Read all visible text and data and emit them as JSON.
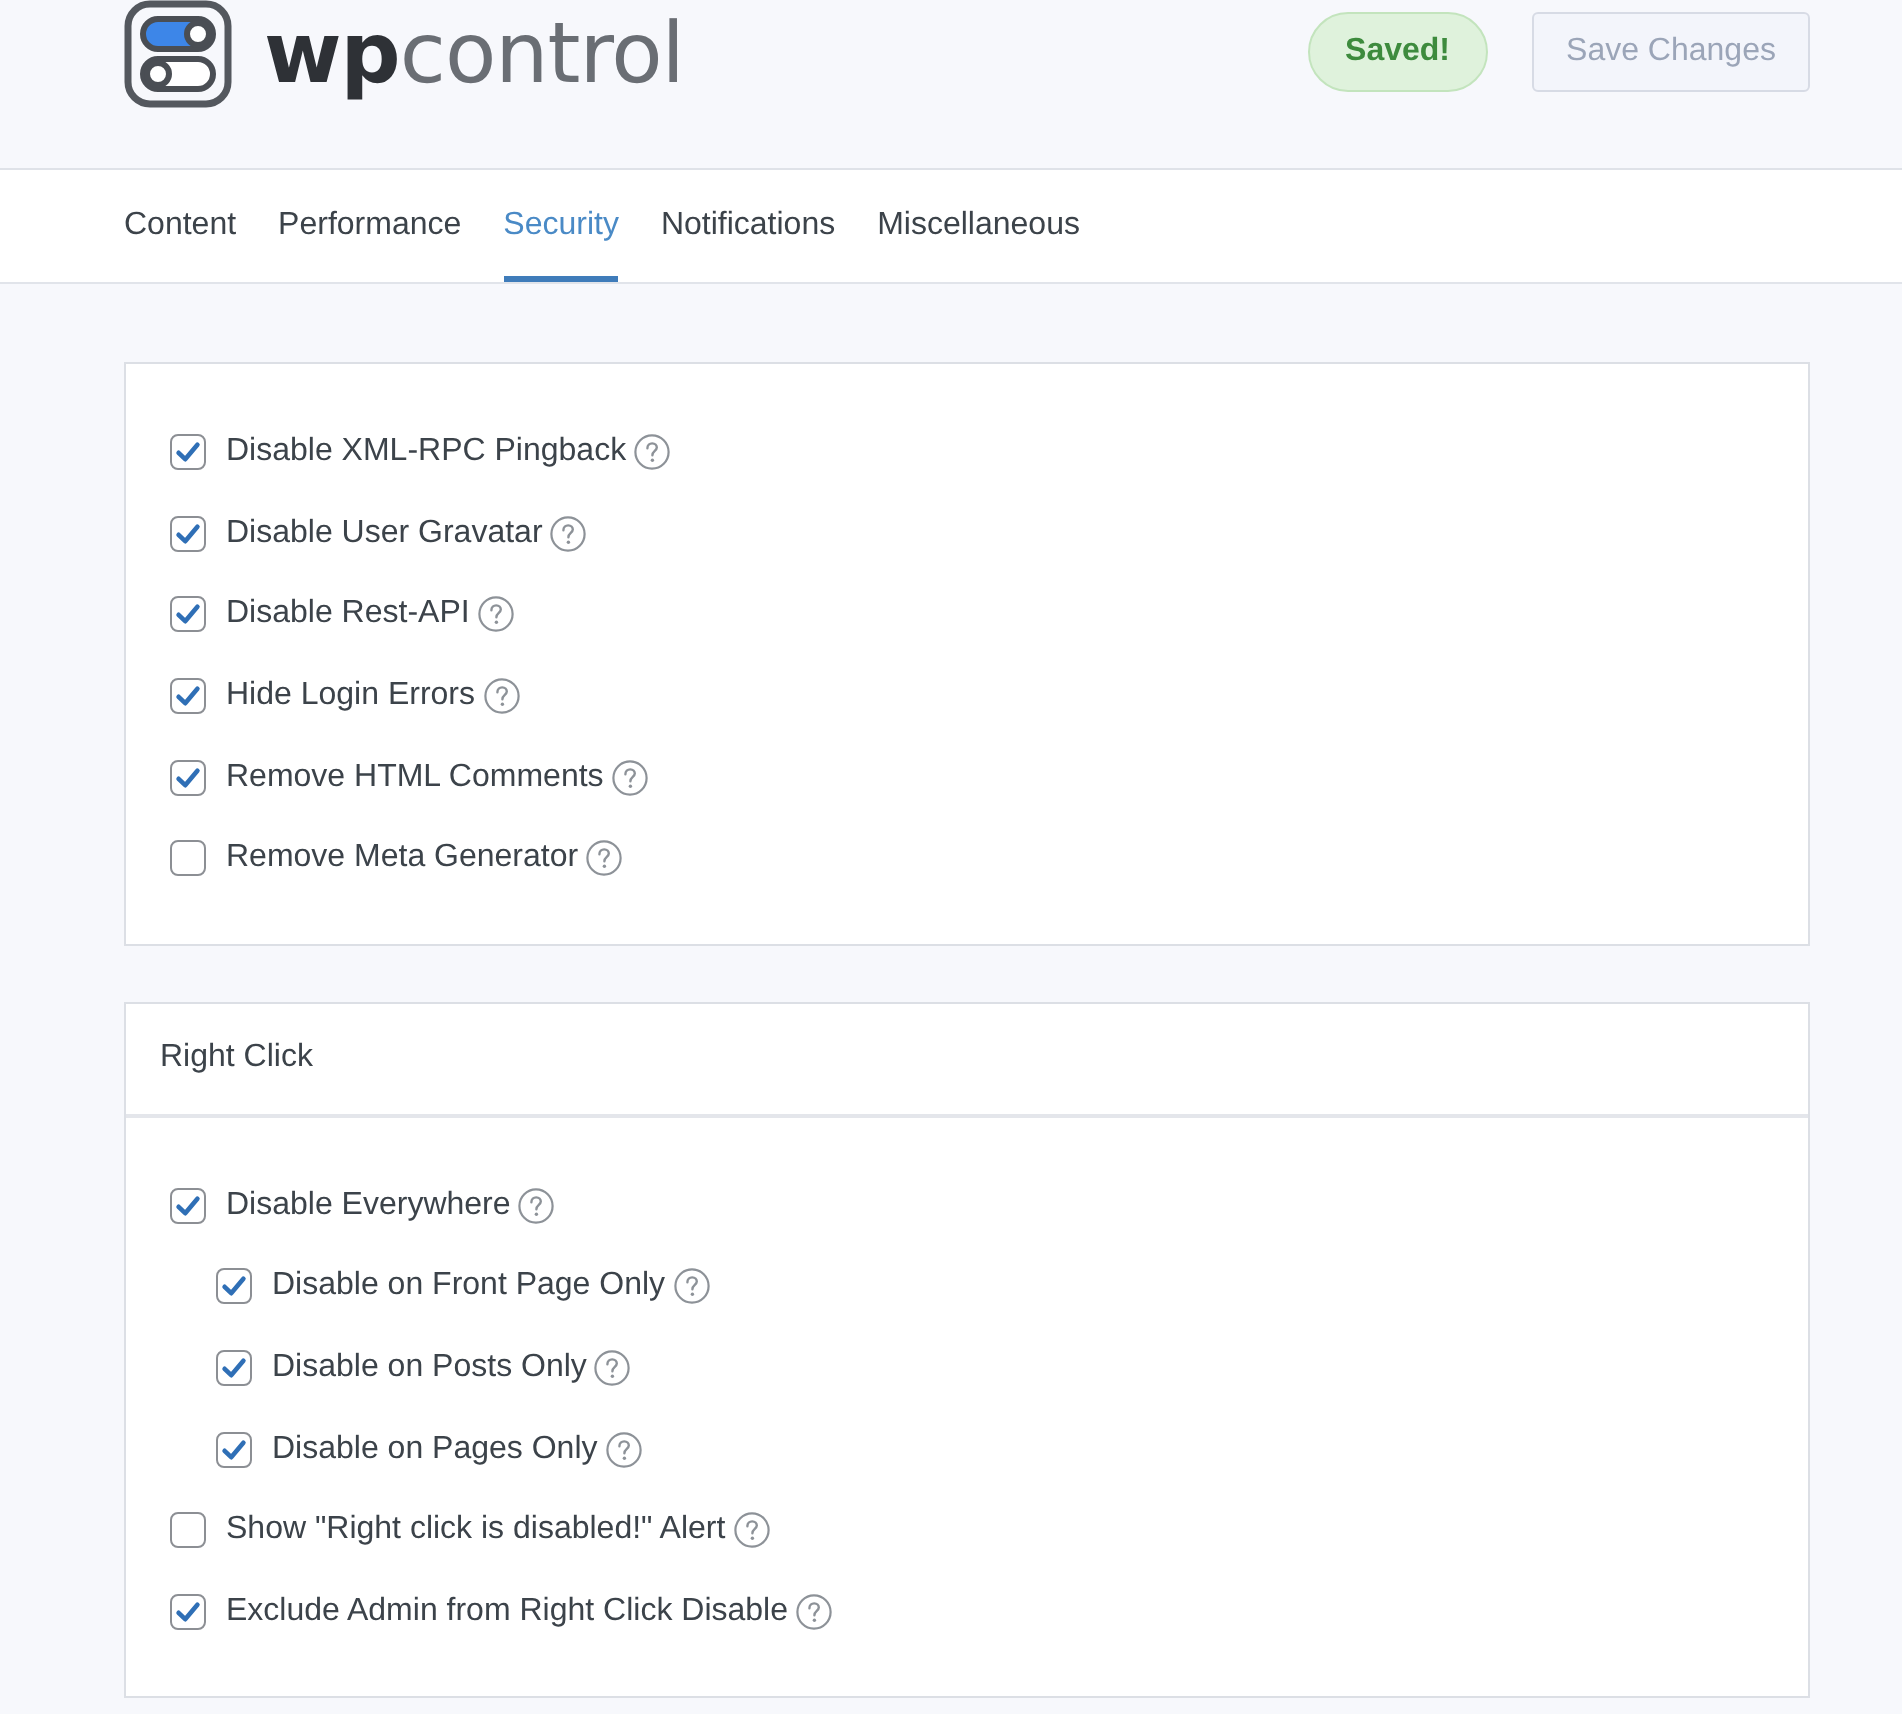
{
  "header": {
    "logo": {
      "text": "**wp**control"
    },
    "status_badge": {
      "text": "Saved!"
    },
    "save_button": {
      "label": "Save Changes",
      "disabled": true
    }
  },
  "tabs": [
    {
      "label": "Content",
      "selected": false
    },
    {
      "label": "Performance",
      "selected": false
    },
    {
      "label": "Security",
      "selected": true
    },
    {
      "label": "Notifications",
      "selected": false
    },
    {
      "label": "Miscellaneous",
      "selected": false
    }
  ],
  "sections": [
    {
      "options": [
        {
          "label": "Disable XML-RPC Pingback",
          "checked": true
        },
        {
          "label": "Disable User Gravatar",
          "checked": true
        },
        {
          "label": "Disable Rest-API",
          "checked": true
        },
        {
          "label": "Hide Login Errors",
          "checked": true
        },
        {
          "label": "Remove HTML Comments",
          "checked": true
        },
        {
          "label": "Remove Meta Generator",
          "checked": false
        }
      ]
    },
    {
      "title": "Right Click",
      "options": [
        {
          "label": "Disable Everywhere",
          "checked": true,
          "children": [
            {
              "label": "Disable on Front Page Only",
              "checked": true
            },
            {
              "label": "Disable on Posts Only",
              "checked": true
            },
            {
              "label": "Disable on Pages Only",
              "checked": true
            }
          ]
        },
        {
          "label": "Show \"Right click is disabled!\" Alert",
          "checked": false
        },
        {
          "label": "Exclude Admin from Right Click Disable",
          "checked": true
        }
      ]
    }
  ]
}
